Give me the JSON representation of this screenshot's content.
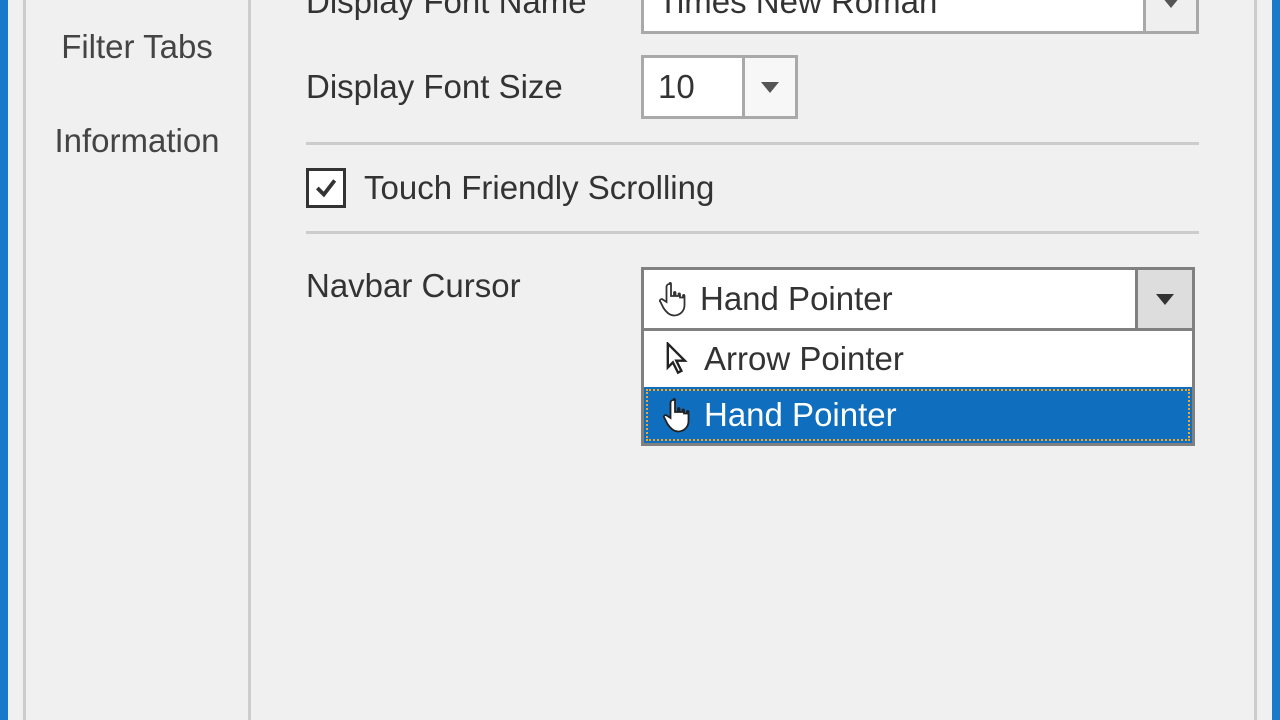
{
  "sidebar": {
    "items": [
      {
        "label": "Filter Tabs"
      },
      {
        "label": "Information"
      }
    ]
  },
  "main": {
    "font_name": {
      "label": "Display Font Name",
      "value": "Times New Roman"
    },
    "font_size": {
      "label": "Display Font Size",
      "value": "10"
    },
    "touch_scroll": {
      "label": "Touch Friendly Scrolling",
      "checked": true
    },
    "navbar_cursor": {
      "label": "Navbar Cursor",
      "selected": "Hand Pointer",
      "options": [
        {
          "icon": "arrow",
          "label": "Arrow Pointer"
        },
        {
          "icon": "hand",
          "label": "Hand Pointer"
        }
      ]
    }
  }
}
